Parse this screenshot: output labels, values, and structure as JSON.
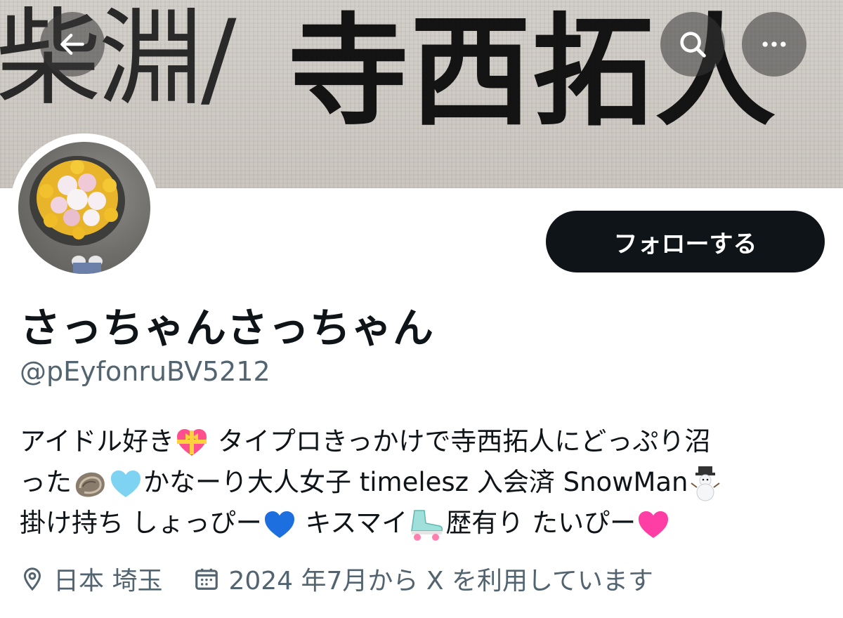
{
  "banner": {
    "text_left": "柴淵/",
    "text_right": "寺西拓人"
  },
  "nav": {
    "back_icon": "arrow-left-icon",
    "search_icon": "search-icon",
    "more_icon": "more-horizontal-icon"
  },
  "profile": {
    "follow_label": "フォローする",
    "display_name": "さっちゃんさっちゃん",
    "handle": "@pEyfonruBV5212",
    "bio": {
      "line1_a": "アイドル好き",
      "line1_b": " タイプロきっかけで寺西拓人にどっぷり沼",
      "line2_a": "った",
      "line2_b": "かなーり大人女子 timelesz 入会済 SnowMan",
      "line3_a": "掛け持ち しょっぴー",
      "line3_b": " キスマイ",
      "line3_c": "歴有り たいぴー"
    },
    "location": "日本 埼玉",
    "joined": "2024 年7月から X を利用しています"
  },
  "colors": {
    "follow_button_bg": "#0f1419",
    "secondary_text": "#536471",
    "heart_light_blue": "#7fd3f2",
    "heart_blue": "#1d6fe0",
    "heart_pink": "#ff3ea5"
  }
}
